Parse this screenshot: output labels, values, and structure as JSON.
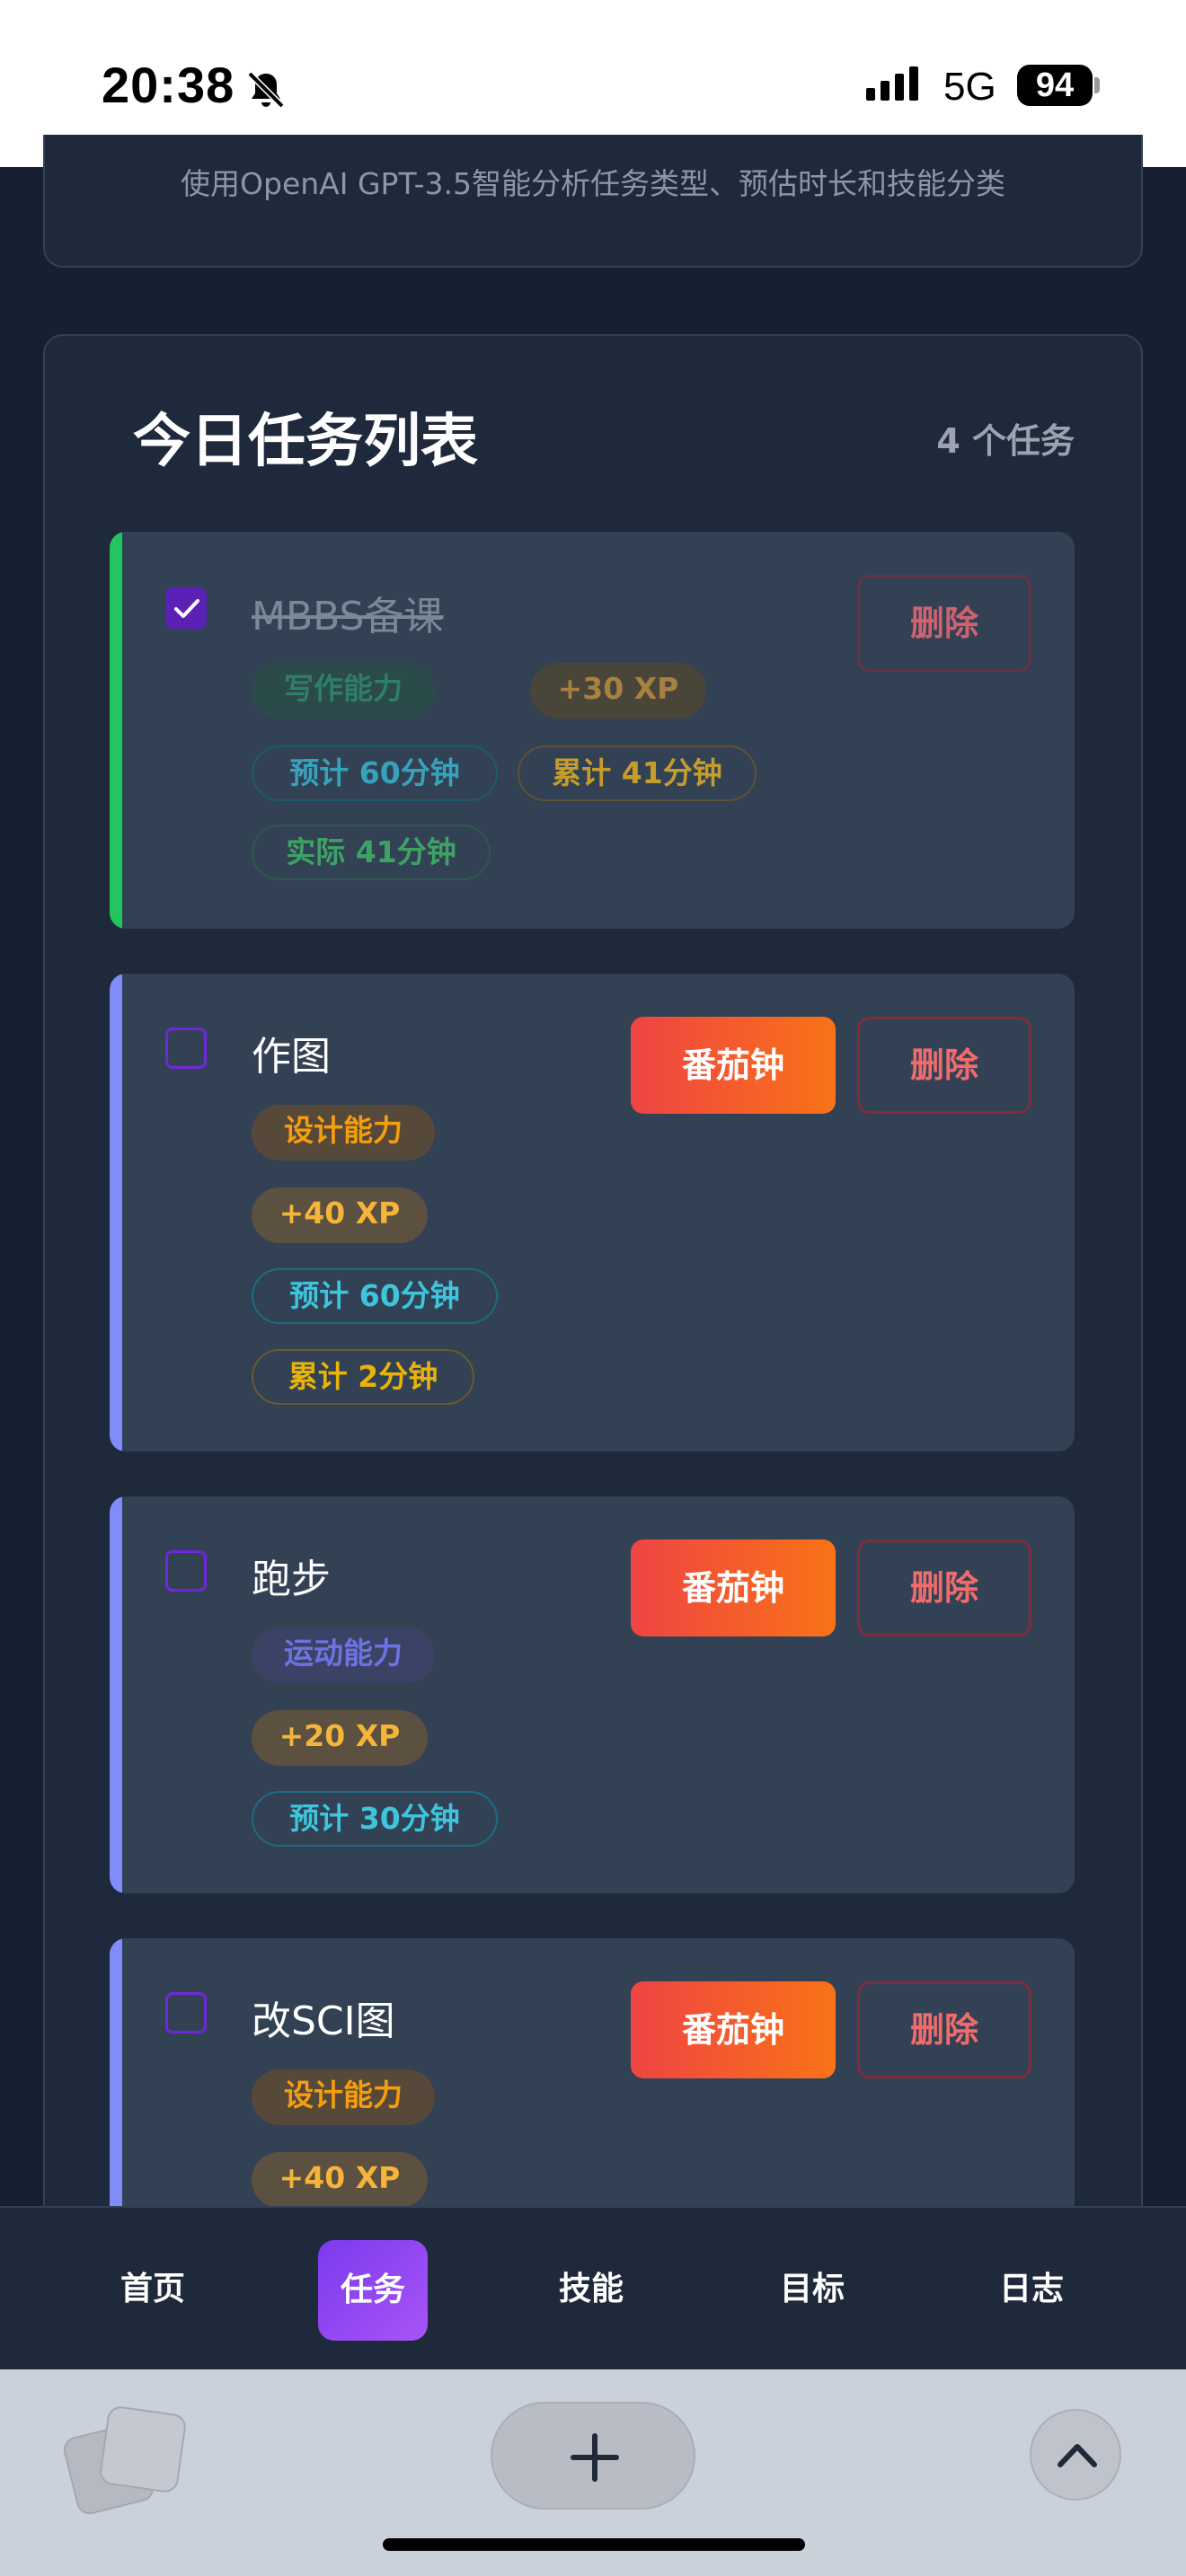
{
  "status_bar": {
    "time": "20:38",
    "network": "5G",
    "battery": "94"
  },
  "ai_card": {
    "description": "使用OpenAI GPT-3.5智能分析任务类型、预估时长和技能分类"
  },
  "task_panel": {
    "title": "今日任务列表",
    "count": "4 个任务"
  },
  "tasks": [
    {
      "name": "MBBS备课",
      "completed": true,
      "skill": "写作能力",
      "xp": "+30 XP",
      "estimate": "预计 60分钟",
      "accumulated": "累计 41分钟",
      "actual": "实际 41分钟",
      "delete_label": "删除",
      "accent_color": "#22c55e"
    },
    {
      "name": "作图",
      "completed": false,
      "skill": "设计能力",
      "xp": "+40 XP",
      "estimate": "预计 60分钟",
      "accumulated": "累计 2分钟",
      "pomodoro_label": "番茄钟",
      "delete_label": "删除",
      "accent_color": "#818cf8"
    },
    {
      "name": "跑步",
      "completed": false,
      "skill": "运动能力",
      "xp": "+20 XP",
      "estimate": "预计 30分钟",
      "pomodoro_label": "番茄钟",
      "delete_label": "删除",
      "accent_color": "#818cf8"
    },
    {
      "name": "改SCI图",
      "completed": false,
      "skill": "设计能力",
      "xp": "+40 XP",
      "pomodoro_label": "番茄钟",
      "delete_label": "删除",
      "accent_color": "#818cf8"
    }
  ],
  "bottom_nav": {
    "items": [
      "首页",
      "任务",
      "技能",
      "目标",
      "日志"
    ],
    "active": "任务"
  },
  "browser_toolbar": {
    "icons": [
      "tabs-icon",
      "plus-icon",
      "chevron-up-icon"
    ]
  }
}
